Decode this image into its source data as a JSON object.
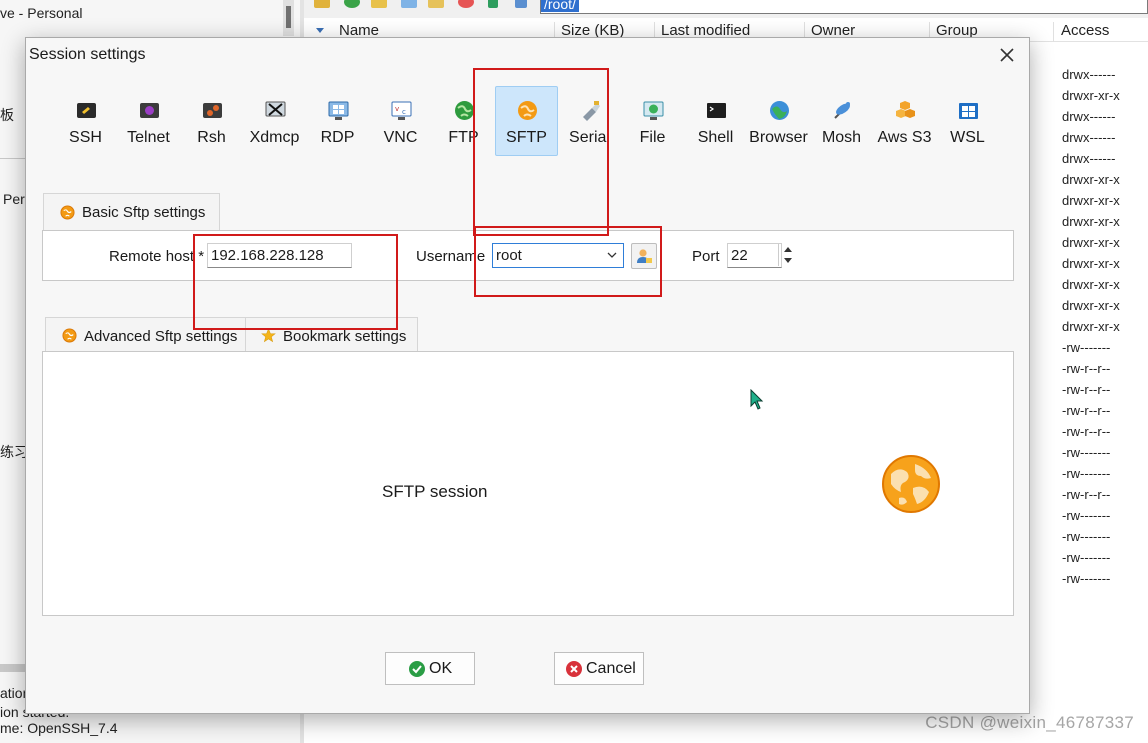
{
  "background": {
    "left_pane_lines": [
      "ve - Personal",
      "板",
      "Per",
      "练习"
    ],
    "path_value": "/root/",
    "columns": [
      "Name",
      "Size (KB)",
      "Last modified",
      "Owner",
      "Group",
      "Access"
    ],
    "access_values": [
      "drwx------",
      "drwxr-xr-x",
      "drwx------",
      "drwx------",
      "drwx------",
      "drwxr-xr-x",
      "drwxr-xr-x",
      "drwxr-xr-x",
      "drwxr-xr-x",
      "drwxr-xr-x",
      "drwxr-xr-x",
      "drwxr-xr-x",
      "drwxr-xr-x",
      "-rw-------",
      "-rw-r--r--",
      "-rw-r--r--",
      "-rw-r--r--",
      "-rw-r--r--",
      "-rw-------",
      "-rw-------",
      "-rw-r--r--",
      "-rw-------",
      "-rw-------",
      "-rw-------",
      "-rw-------"
    ],
    "bottom_lines": [
      "ation",
      "ion started.",
      "me: OpenSSH_7.4"
    ],
    "watermark": "CSDN @weixin_46787337"
  },
  "dialog": {
    "title": "Session settings",
    "session_types": [
      {
        "label": "SSH",
        "icon": "ssh-icon",
        "color": "#2b2b2b"
      },
      {
        "label": "Telnet",
        "icon": "telnet-icon",
        "color": "#7a2b8f"
      },
      {
        "label": "Rsh",
        "icon": "rsh-icon",
        "color": "#c8561b"
      },
      {
        "label": "Xdmcp",
        "icon": "xdmcp-icon",
        "color": "#555555"
      },
      {
        "label": "RDP",
        "icon": "rdp-icon",
        "color": "#2e7fcf"
      },
      {
        "label": "VNC",
        "icon": "vnc-icon",
        "color": "#3a6fb5"
      },
      {
        "label": "FTP",
        "icon": "ftp-icon",
        "color": "#2c8a3a"
      },
      {
        "label": "SFTP",
        "icon": "sftp-icon",
        "color": "#f08c00"
      },
      {
        "label": "Serial",
        "icon": "serial-icon",
        "color": "#7a8a96"
      },
      {
        "label": "File",
        "icon": "file-icon",
        "color": "#3a8fa8"
      },
      {
        "label": "Shell",
        "icon": "shell-icon",
        "color": "#222222"
      },
      {
        "label": "Browser",
        "icon": "browser-icon",
        "color": "#2d9b58"
      },
      {
        "label": "Mosh",
        "icon": "mosh-icon",
        "color": "#3f7ec4"
      },
      {
        "label": "Aws S3",
        "icon": "aws-s3-icon",
        "color": "#f3a42b"
      },
      {
        "label": "WSL",
        "icon": "wsl-icon",
        "color": "#1f6fc5"
      }
    ],
    "selected_type": "SFTP",
    "basic_tab_label": "Basic Sftp settings",
    "remote_host_label": "Remote host *",
    "remote_host_value": "192.168.228.128",
    "username_label": "Username",
    "username_value": "root",
    "port_label": "Port",
    "port_value": "22",
    "advanced_tab_label": "Advanced Sftp settings",
    "bookmark_tab_label": "Bookmark settings",
    "session_description": "SFTP session",
    "ok_label": "OK",
    "cancel_label": "Cancel"
  }
}
